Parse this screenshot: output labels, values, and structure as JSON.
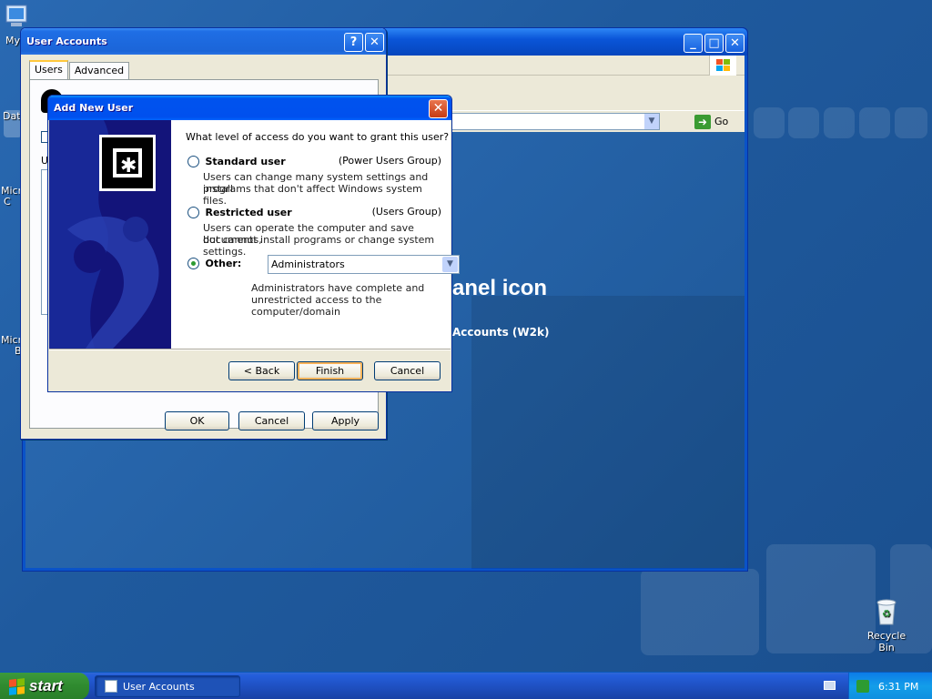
{
  "desktop": {
    "icons": [
      {
        "label": "My",
        "icon": "computer-icon"
      },
      {
        "label": "Dat",
        "icon": "database-icon"
      },
      {
        "label": "Micro",
        "icon": "app-icon"
      },
      {
        "label": "C",
        "icon": "app-icon"
      },
      {
        "label": "Micro",
        "icon": "app-icon"
      },
      {
        "label": "B",
        "icon": "app-icon"
      }
    ],
    "recycle_bin_label": "Recycle Bin"
  },
  "bg_window": {
    "go_label": "Go",
    "heading": "anel icon",
    "subheading": "Accounts (W2k)",
    "minimize_glyph": "_",
    "maximize_glyph": "□",
    "close_glyph": "✕"
  },
  "user_accounts": {
    "title": "User Accounts",
    "help_glyph": "?",
    "close_glyph": "✕",
    "tabs": [
      "Users",
      "Advanced"
    ],
    "panel_fragments": [
      "U",
      "U"
    ],
    "ok_label": "OK",
    "cancel_label": "Cancel",
    "apply_label": "Apply"
  },
  "wizard": {
    "title": "Add New User",
    "close_glyph": "✕",
    "question": "What level of access do you want to grant this user?",
    "options": [
      {
        "label": "Standard user",
        "group": "(Power Users Group)",
        "desc1": "Users can change many system settings and install",
        "desc2": "programs that don't affect Windows system files.",
        "checked": false
      },
      {
        "label": "Restricted user",
        "group": "(Users Group)",
        "desc1": "Users can operate the computer and save documents,",
        "desc2": "but cannot install programs or change system settings.",
        "checked": false
      },
      {
        "label": "Other:",
        "selected_value": "Administrators",
        "desc1": "Administrators have complete and",
        "desc2": "unrestricted access to the",
        "desc3": "computer/domain",
        "checked": true
      }
    ],
    "back_label": "< Back",
    "finish_label": "Finish",
    "cancel_label": "Cancel"
  },
  "taskbar": {
    "start_label": "start",
    "task_item_label": "User Accounts",
    "clock": "6:31 PM"
  },
  "colors": {
    "desktop": "#1f5a9e",
    "xp_blue_title": "#0053ee",
    "start_green": "#2f8a2f",
    "tray_blue": "#139ee9"
  }
}
